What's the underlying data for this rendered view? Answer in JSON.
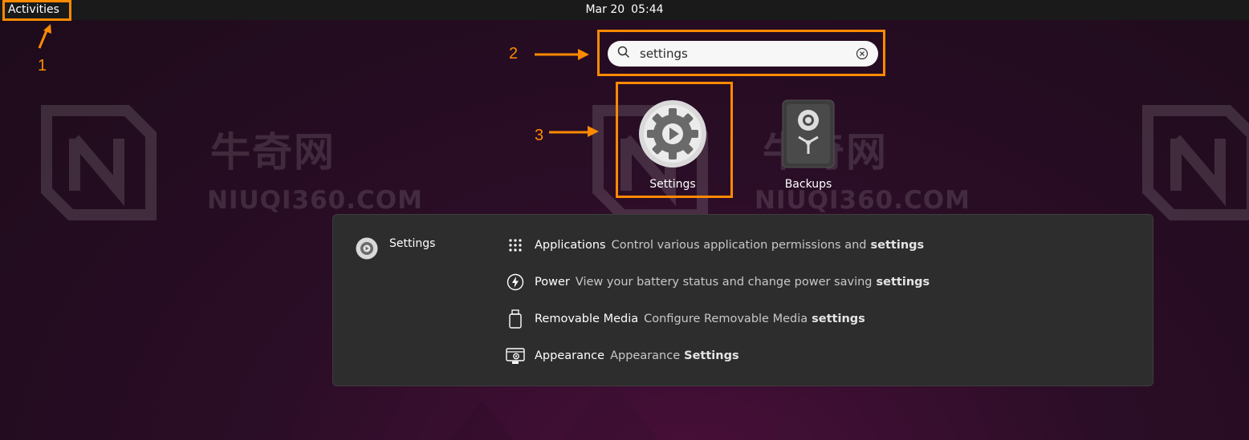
{
  "topbar": {
    "activities": "Activities",
    "date": "Mar 20",
    "time": "05:44"
  },
  "annotations": {
    "step1": "1",
    "step2": "2",
    "step3": "3",
    "color": "#ff8a00"
  },
  "search": {
    "value": "settings",
    "icon": "search-icon",
    "clear_icon": "clear-icon"
  },
  "apps": [
    {
      "label": "Settings",
      "icon": "gear-icon"
    },
    {
      "label": "Backups",
      "icon": "safe-icon"
    }
  ],
  "watermark": {
    "chinese": "牛奇网",
    "domain": "NIUQI360.COM"
  },
  "results": {
    "app_name": "Settings",
    "items": [
      {
        "title": "Applications",
        "desc": "Control various application permissions and",
        "match": "settings",
        "icon": "apps-grid-icon"
      },
      {
        "title": "Power",
        "desc": "View your battery status and change power saving",
        "match": "settings",
        "icon": "power-icon"
      },
      {
        "title": "Removable Media",
        "desc": "Configure Removable Media",
        "match": "settings",
        "icon": "usb-drive-icon"
      },
      {
        "title": "Appearance",
        "desc": "Appearance",
        "match": "Settings",
        "icon": "appearance-icon"
      }
    ]
  }
}
